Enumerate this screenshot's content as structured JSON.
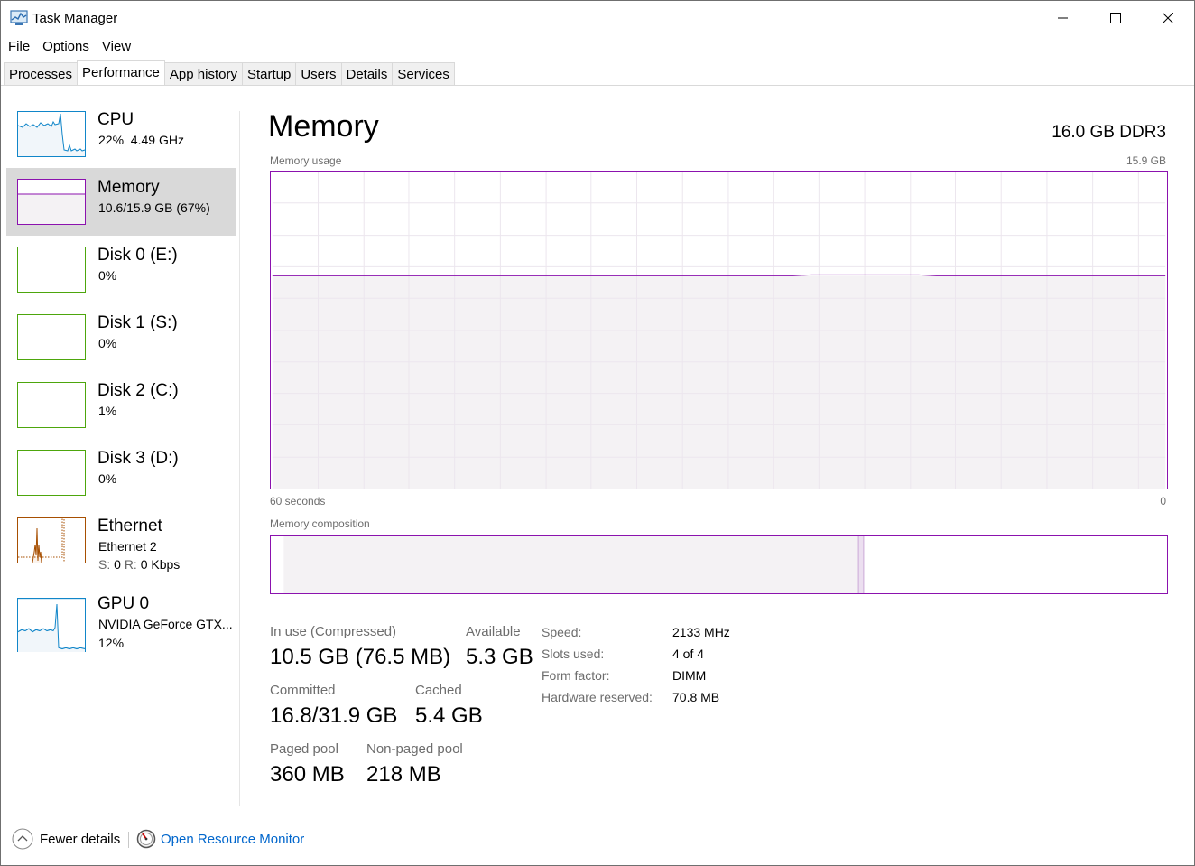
{
  "window": {
    "title": "Task Manager",
    "icon": "task-manager-icon"
  },
  "menu": [
    "File",
    "Options",
    "View"
  ],
  "tabs": [
    {
      "label": "Processes"
    },
    {
      "label": "Performance",
      "active": true
    },
    {
      "label": "App history"
    },
    {
      "label": "Startup"
    },
    {
      "label": "Users"
    },
    {
      "label": "Details"
    },
    {
      "label": "Services"
    }
  ],
  "sidebar": [
    {
      "title": "CPU",
      "sub": "22%  4.49 GHz",
      "color": "#1186c9"
    },
    {
      "title": "Memory",
      "sub": "10.6/15.9 GB (67%)",
      "color": "#8b12ae",
      "selected": true
    },
    {
      "title": "Disk 0 (E:)",
      "sub": "0%",
      "color": "#4da60c"
    },
    {
      "title": "Disk 1 (S:)",
      "sub": "0%",
      "color": "#4da60c"
    },
    {
      "title": "Disk 2 (C:)",
      "sub": "1%",
      "color": "#4da60c"
    },
    {
      "title": "Disk 3 (D:)",
      "sub": "0%",
      "color": "#4da60c"
    },
    {
      "title": "Ethernet",
      "sub": "Ethernet 2",
      "send_label": "S:",
      "send": "0",
      "recv_label": "R:",
      "recv": "0 Kbps",
      "color": "#a74f01"
    },
    {
      "title": "GPU 0",
      "sub": "NVIDIA GeForce GTX...",
      "sub2": "12%",
      "color": "#1186c9"
    }
  ],
  "main": {
    "title": "Memory",
    "spec": "16.0 GB DDR3",
    "usage_label": "Memory usage",
    "usage_max": "15.9 GB",
    "time_left": "60 seconds",
    "time_right": "0",
    "composition_label": "Memory composition",
    "usage_fraction": 0.67,
    "composition": {
      "in_use": 10.5,
      "modified": 0.1,
      "total": 15.9
    }
  },
  "stats": {
    "in_use_label": "In use (Compressed)",
    "in_use_value": "10.5 GB (76.5 MB)",
    "available_label": "Available",
    "available_value": "5.3 GB",
    "committed_label": "Committed",
    "committed_value": "16.8/31.9 GB",
    "cached_label": "Cached",
    "cached_value": "5.4 GB",
    "paged_label": "Paged pool",
    "paged_value": "360 MB",
    "nonpaged_label": "Non-paged pool",
    "nonpaged_value": "218 MB"
  },
  "props": {
    "speed_label": "Speed:",
    "speed_value": "2133 MHz",
    "slots_label": "Slots used:",
    "slots_value": "4 of 4",
    "form_label": "Form factor:",
    "form_value": "DIMM",
    "reserved_label": "Hardware reserved:",
    "reserved_value": "70.8 MB"
  },
  "footer": {
    "fewer_details": "Fewer details",
    "resource_monitor": "Open Resource Monitor"
  }
}
